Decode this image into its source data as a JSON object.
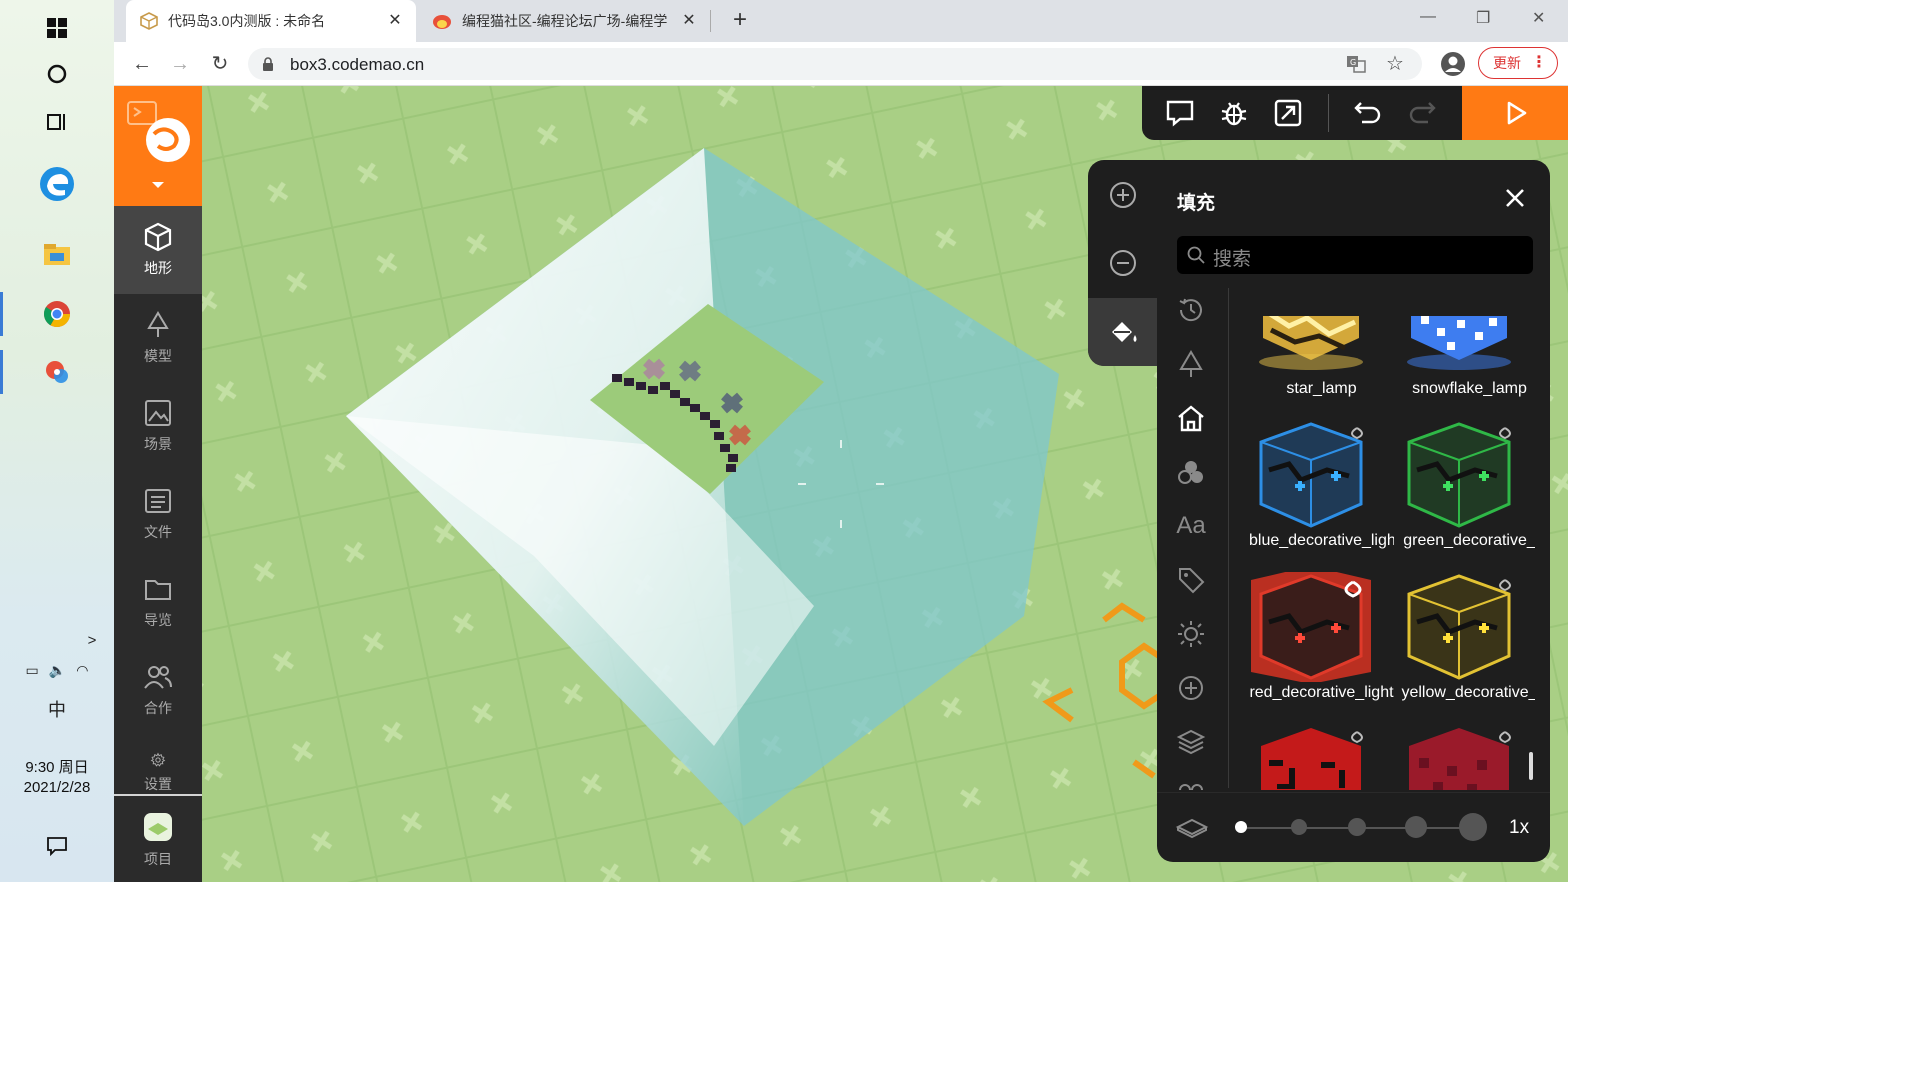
{
  "taskbar": {
    "icons": [
      "windows-start-icon",
      "cortana-icon",
      "task-view-icon",
      "edge-icon",
      "file-explorer-icon",
      "chrome-icon",
      "app-icon"
    ],
    "tray_expand": ">",
    "ime": "中",
    "time": "9:30 周日",
    "date": "2021/2/28"
  },
  "browser": {
    "tabs": [
      {
        "title": "代码岛3.0内测版 : 未命名",
        "active": true
      },
      {
        "title": "编程猫社区-编程论坛广场-编程学",
        "active": false
      }
    ],
    "new_tab": "+",
    "url": "box3.codemao.cn",
    "update_label": "更新"
  },
  "app": {
    "sidebar": [
      {
        "label": "地形",
        "icon": "cube-icon",
        "active": true
      },
      {
        "label": "模型",
        "icon": "tree-icon",
        "active": false
      },
      {
        "label": "场景",
        "icon": "image-icon",
        "active": false
      },
      {
        "label": "文件",
        "icon": "file-icon",
        "active": false
      },
      {
        "label": "导览",
        "icon": "folder-icon",
        "active": false
      },
      {
        "label": "合作",
        "icon": "users-icon",
        "active": false
      },
      {
        "label": "设置",
        "icon": "gear-icon",
        "active": false
      },
      {
        "label": "项目",
        "icon": "project-icon",
        "active": false
      }
    ],
    "panel": {
      "title": "填充",
      "search_placeholder": "搜索",
      "items": [
        {
          "name": "star_lamp",
          "color": "#e8c24a"
        },
        {
          "name": "snowflake_lamp",
          "color": "#3e7df0"
        },
        {
          "name": "blue_decorative_light",
          "color": "#2d8fe6"
        },
        {
          "name": "green_decorative_",
          "color": "#2fb847"
        },
        {
          "name": "red_decorative_light",
          "color": "#e03a2a"
        },
        {
          "name": "yellow_decorative_",
          "color": "#e2c233"
        },
        {
          "name": "",
          "color": "#c41a1a"
        },
        {
          "name": "",
          "color": "#9a1a2a"
        }
      ],
      "categories_text": "Aa",
      "zoom": "1x"
    }
  },
  "colors": {
    "accent": "#ff7a14",
    "panel_bg": "#1e1e1e",
    "grass": "#a9cf85",
    "water": "#7fc7cf"
  }
}
